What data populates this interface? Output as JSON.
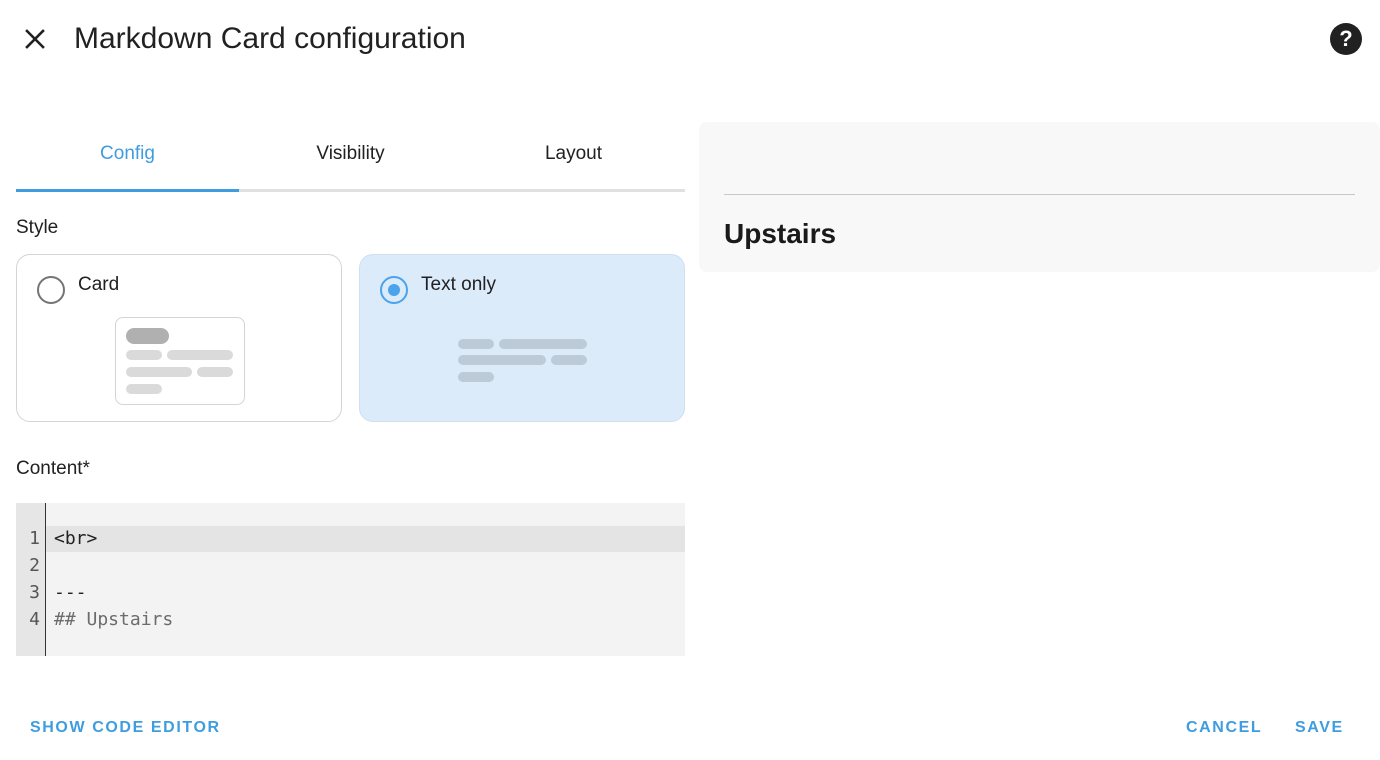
{
  "header": {
    "title": "Markdown Card configuration"
  },
  "tabs": [
    {
      "label": "Config",
      "active": true
    },
    {
      "label": "Visibility",
      "active": false
    },
    {
      "label": "Layout",
      "active": false
    }
  ],
  "style": {
    "label": "Style",
    "options": [
      {
        "label": "Card",
        "selected": false
      },
      {
        "label": "Text only",
        "selected": true
      }
    ]
  },
  "content": {
    "label": "Content*",
    "lines": [
      {
        "number": "1",
        "text": "<br>"
      },
      {
        "number": "2",
        "text": ""
      },
      {
        "number": "3",
        "text": "---"
      },
      {
        "number": "4",
        "text": "## Upstairs"
      }
    ]
  },
  "preview": {
    "heading": "Upstairs"
  },
  "footer": {
    "show_code_editor": "SHOW CODE EDITOR",
    "cancel": "CANCEL",
    "save": "SAVE"
  },
  "colors": {
    "accent": "#3f9ddf",
    "selected_option_bg": "#dbebfa",
    "radio_checked": "#4aa3ec"
  },
  "icons": {
    "close": "close-icon",
    "help": "help-circle-icon"
  }
}
